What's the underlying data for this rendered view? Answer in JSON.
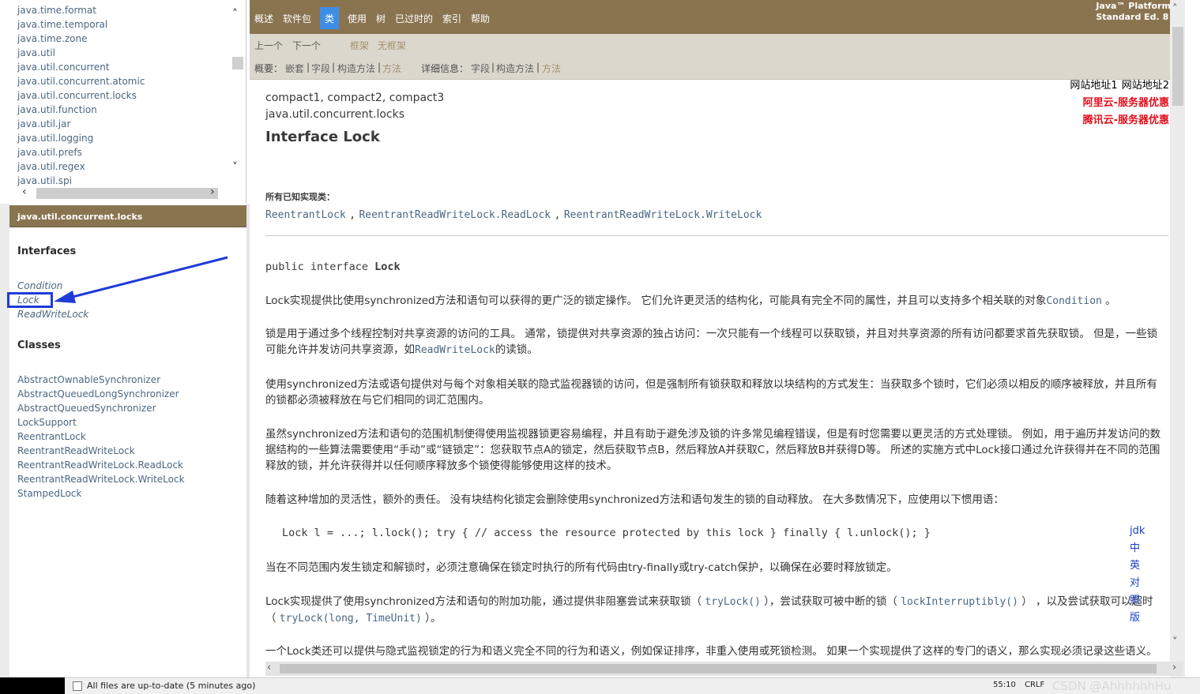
{
  "packages": [
    "java.time.format",
    "java.time.temporal",
    "java.time.zone",
    "java.util",
    "java.util.concurrent",
    "java.util.concurrent.atomic",
    "java.util.concurrent.locks",
    "java.util.function",
    "java.util.jar",
    "java.util.logging",
    "java.util.prefs",
    "java.util.regex",
    "java.util.spi"
  ],
  "class_frame": {
    "header": "java.util.concurrent.locks",
    "interfaces_title": "Interfaces",
    "interfaces": [
      "Condition",
      "Lock",
      "ReadWriteLock"
    ],
    "classes_title": "Classes",
    "classes": [
      "AbstractOwnableSynchronizer",
      "AbstractQueuedLongSynchronizer",
      "AbstractQueuedSynchronizer",
      "LockSupport",
      "ReentrantLock",
      "ReentrantReadWriteLock",
      "ReentrantReadWriteLock.ReadLock",
      "ReentrantReadWriteLock.WriteLock",
      "StampedLock"
    ]
  },
  "topnav": {
    "items": [
      "概述",
      "软件包",
      "类",
      "使用",
      "树",
      "已过时的",
      "索引",
      "帮助"
    ],
    "active": "类",
    "brand_line1": "Java™ Platform",
    "brand_line2": "Standard Ed. 8"
  },
  "subnav": {
    "prev": "上一个",
    "next": "下一个",
    "frames": "框架",
    "noframes": "无框架",
    "summary_label": "概要：",
    "summary_nested": "嵌套",
    "summary_field": "字段",
    "summary_ctor": "构造方法",
    "summary_method": "方法",
    "detail_label": "详细信息：",
    "detail_field": "字段",
    "detail_ctor": "构造方法",
    "detail_method": "方法",
    "sep": "|"
  },
  "ads": {
    "site1": "网站地址1",
    "site2": "网站地址2",
    "aliyun": "阿里云-服务器优惠",
    "tencent": "腾讯云-服务器优惠"
  },
  "content": {
    "profiles": "compact1, compact2, compact3",
    "package": "java.util.concurrent.locks",
    "title": "Interface Lock",
    "impl_label": "所有已知实现类：",
    "impl_classes": [
      "ReentrantLock",
      "ReentrantReadWriteLock.ReadLock",
      "ReentrantReadWriteLock.WriteLock"
    ],
    "impl_sep": ",",
    "decl_prefix": "public interface ",
    "decl_name": "Lock",
    "p1_a": "Lock实现提供比使用synchronized方法和语句可以获得的更广泛的锁定操作。 它们允许更灵活的结构化，可能具有完全不同的属性，并且可以支持多个相关联的对象",
    "p1_link": "Condition",
    "p1_b": " 。",
    "p2_a": "锁是用于通过多个线程控制对共享资源的访问的工具。 通常，锁提供对共享资源的独占访问：一次只能有一个线程可以获取锁，并且对共享资源的所有访问都要求首先获取锁。 但是，一些锁可能允许并发访问共享资源，如",
    "p2_link": "ReadWriteLock",
    "p2_b": "的读锁。",
    "p3": "使用synchronized方法或语句提供对与每个对象相关联的隐式监视器锁的访问，但是强制所有锁获取和释放以块结构的方式发生：当获取多个锁时，它们必须以相反的顺序被释放，并且所有的锁都必须被释放在与它们相同的词汇范围内。",
    "p4": "虽然synchronized方法和语句的范围机制使得使用监视器锁更容易编程，并且有助于避免涉及锁的许多常见编程错误，但是有时您需要以更灵活的方式处理锁。 例如，用于遍历并发访问的数据结构的一些算法需要使用“手动”或“链锁定”：您获取节点A的锁定，然后获取节点B，然后释放A并获取C，然后释放B并获得D等。 所述的实施方式中Lock接口通过允许获得并在不同的范围释放的锁，并允许获得并以任何顺序释放多个锁使得能够使用这样的技术。",
    "p5": "随着这种增加的灵活性，额外的责任。 没有块结构化锁定会删除使用synchronized方法和语句发生的锁的自动释放。 在大多数情况下，应使用以下惯用语：",
    "code": "Lock l = ...; l.lock(); try { // access the resource protected by this lock } finally { l.unlock(); }",
    "p6": "当在不同范围内发生锁定和解锁时，必须注意确保在锁定时执行的所有代码由try-finally或try-catch保护，以确保在必要时释放锁定。",
    "p7_a": "Lock实现提供了使用synchronized方法和语句的附加功能，通过提供非阻塞尝试来获取锁（ ",
    "p7_link1": "tryLock()",
    "p7_b": " ），尝试获取可被中断的锁（ ",
    "p7_link2": "lockInterruptibly()",
    "p7_c": " ） ，以及尝试获取可以超时（ ",
    "p7_link3": "tryLock(long, TimeUnit)",
    "p7_d": " ）。",
    "p8": "一个Lock类还可以提供与隐式监视锁定的行为和语义完全不同的行为和语义，例如保证排序，非重入使用或死锁检测。 如果一个实现提供了这样的专门的语义，那么实现必须记录这些语义。"
  },
  "jdk_links": [
    "jdk",
    "中",
    "英",
    "对",
    "照",
    "版"
  ],
  "statusbar": {
    "message": "All files are up-to-date (5 minutes ago)",
    "position": "55:10",
    "line_ending": "CRLF",
    "watermark": "CSDN @AhhhhhhHu"
  },
  "colors": {
    "nav_bg": "#8a7450",
    "nav_active": "#3e8ee6",
    "subnav_bg": "#dcd7cd",
    "link": "#4a6782",
    "ad_red": "#e0101b",
    "annotation_blue": "#1f3bd8"
  }
}
